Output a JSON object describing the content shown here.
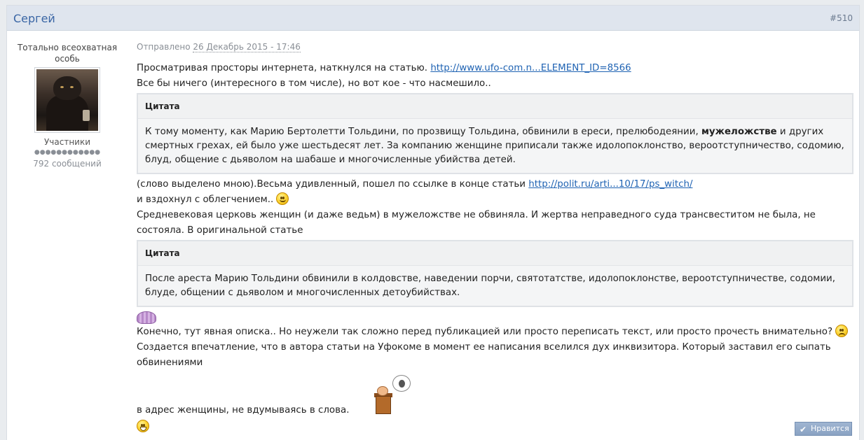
{
  "post": {
    "author": "Сергей",
    "number": "#510"
  },
  "profile": {
    "title": "Тотально всеохватная особь",
    "group": "Участники",
    "pips": "●●●●●●●●●●●●",
    "posts_count": "792 сообщений"
  },
  "meta": {
    "prefix": "Отправлено",
    "date": "26 Декабрь 2015 - 17:46"
  },
  "body": {
    "line1_text": "Просматривая просторы интернета, наткнулся на статью. ",
    "line1_link": "http://www.ufo-com.n...ELEMENT_ID=8566",
    "line2": "Все бы ничего (интересного в том числе), но вот кое - что насмешило..",
    "quote1_title": "Цитата",
    "quote1_pre": "К тому моменту, как Марию Бертолетти Тольдини, по прозвищу Тольдина, обвинили в ереси, прелюбодеянии, ",
    "quote1_bold": "мужеложстве",
    "quote1_post": " и других смертных грехах, ей было уже шестьдесят лет. За компанию женщине приписали также идолопоклонство, вероотступничество, содомию, блуд, общение с дьяволом на шабаше и многочисленные убийства детей.",
    "line3_text": "(слово выделено мною).Весьма удивленный, пошел по ссылке в конце статьи ",
    "line3_link": "http://polit.ru/arti...10/17/ps_witch/",
    "line4": "и вздохнул с облегчением.. ",
    "line5": "Средневековая церковь женщин (и даже ведьм) в мужеложстве не обвиняла. И жертва неправедного суда трансвеститом не была, не состояла. В оригинальной статье",
    "quote2_title": "Цитата",
    "quote2_body": "После ареста Марию Тольдини обвинили в колдовстве, наведении порчи, святотатстве, идолопоклонстве, вероотступничестве, содомии, блуде, общении с дьяволом и многочисленных детоубийствах.",
    "line6": "Конечно, тут явная описка.. Но неужели так сложно перед публикацией или просто переписать текст, или просто прочесть внимательно? ",
    "line7": "Создается впечатление, что в автора статьи на Уфокоме в момент ее написания вселился дух инквизитора. Который заставил его сыпать обвинениями",
    "line8": "в адрес женщины, не вдумываясь в слова."
  },
  "actions": {
    "like_label": "Нравится"
  },
  "icons": {
    "smile": "smile-icon",
    "sad": "sad-icon",
    "brain": "brain-icon",
    "orator": "orator-icon",
    "grin": "grin-icon",
    "check": "check-icon"
  }
}
